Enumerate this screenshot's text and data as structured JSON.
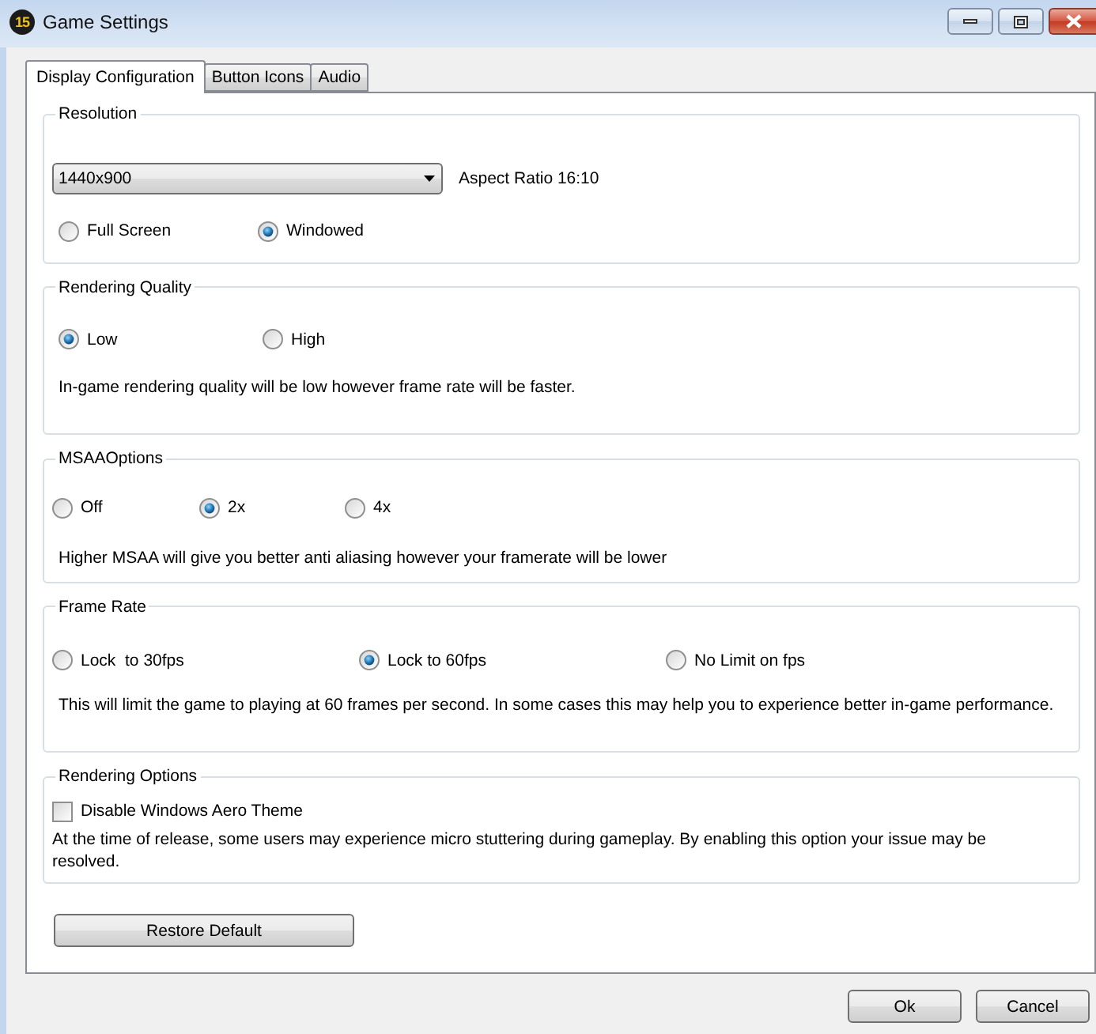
{
  "window": {
    "title": "Game Settings",
    "logo_text": "15"
  },
  "tabs": [
    {
      "label": "Display Configuration",
      "selected": true
    },
    {
      "label": "Button Icons",
      "selected": false
    },
    {
      "label": "Audio",
      "selected": false
    }
  ],
  "groups": [
    {
      "kind": "resolution",
      "title": "Resolution",
      "dropdown": {
        "value": "1440x900"
      },
      "aspect_ratio": "Aspect Ratio 16:10",
      "options": [
        {
          "label": "Full Screen",
          "selected": false
        },
        {
          "label": "Windowed",
          "selected": true
        }
      ]
    },
    {
      "kind": "radio",
      "title": "Rendering Quality",
      "options": [
        {
          "label": "Low",
          "selected": true
        },
        {
          "label": "High",
          "selected": false
        }
      ],
      "description": "In-game rendering quality will be low however frame rate will be faster."
    },
    {
      "kind": "radio",
      "title": "MSAAOptions",
      "options": [
        {
          "label": "Off",
          "selected": false
        },
        {
          "label": "2x",
          "selected": true
        },
        {
          "label": "4x",
          "selected": false
        }
      ],
      "description": "Higher MSAA will give you better anti aliasing however your framerate will be lower"
    },
    {
      "kind": "radio",
      "title": "Frame Rate",
      "options": [
        {
          "label": "Lock  to 30fps",
          "selected": false
        },
        {
          "label": "Lock to 60fps",
          "selected": true
        },
        {
          "label": "No Limit on fps",
          "selected": false
        }
      ],
      "description": "This will limit the game to playing at 60 frames per second. In some cases this may help you to experience better in-game performance."
    },
    {
      "kind": "checkbox",
      "title": "Rendering Options",
      "checkbox": {
        "label": "Disable Windows Aero Theme",
        "checked": false
      },
      "description": "At the time of release, some users may experience micro stuttering during gameplay. By enabling this option your issue may be resolved."
    }
  ],
  "restore_button": "Restore Default",
  "dialog_buttons": [
    "Ok",
    "Cancel"
  ]
}
